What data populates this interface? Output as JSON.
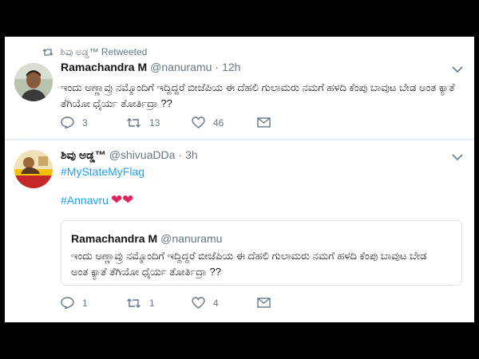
{
  "tweet1": {
    "retweet_label": "ಶಿವು ಅಡ್ಡ™ Retweeted",
    "name": "Ramachandra M",
    "handle": "@nanuramu",
    "dot": "·",
    "time": "12h",
    "text": "ಇಂದು ಅಣ್ಣಾವ್ರು ನಮ್ಮೊಂದಿಗೆ ಇದ್ದಿದ್ದರೆ  ಬೀಜೆಪಿಯ ಈ ದೆಹಲಿ ಗುಲಾಮರು ನಮಗೆ ಹಳದಿ ಕೆಂಪು ಬಾವುಟ ಬೇಡ ಅಂತ ಕ್ಯಾತೆ ತೆಗಿಯೋ ಧೈರ್ಯ ತೋರ್ತಿದ್ರಾ ??",
    "replies": "3",
    "retweets": "13",
    "likes": "46"
  },
  "tweet2": {
    "name": "ಶಿವು ಅಡ್ಡ™",
    "handle": "@shivuaDDa",
    "dot": "·",
    "time": "3h",
    "hashtag1": "#MyStateMyFlag",
    "hashtag2": "#Annavru",
    "hearts": "❤❤",
    "quote": {
      "name": "Ramachandra M",
      "handle": "@nanuramu",
      "text": "ಇಂದು ಅಣ್ಣಾವ್ರು ನಮ್ಮೊಂದಿಗೆ ಇದ್ದಿದ್ದರೆ  ಬೀಜೆಪಿಯ ಈ ದೆಹಲಿ ಗುಲಾಮರು ನಮಗೆ ಹಳದಿ ಕೆಂಪು ಬಾವುಟ ಬೇಡ ಅಂತ ಕ್ಯಾತೆ ತೆಗಿಯೋ ಧೈರ್ಯ ತೋರ್ತಿದ್ರಾ ??"
    },
    "replies": "1",
    "retweets": "1",
    "likes": "4"
  },
  "icons": {
    "retweet": "retweet-icon",
    "reply": "reply-icon",
    "like": "heart-icon",
    "dm": "envelope-icon",
    "more": "chevron-down-icon"
  },
  "colors": {
    "link": "#1da1f2",
    "muted": "#657786",
    "heart": "#e0245e"
  }
}
